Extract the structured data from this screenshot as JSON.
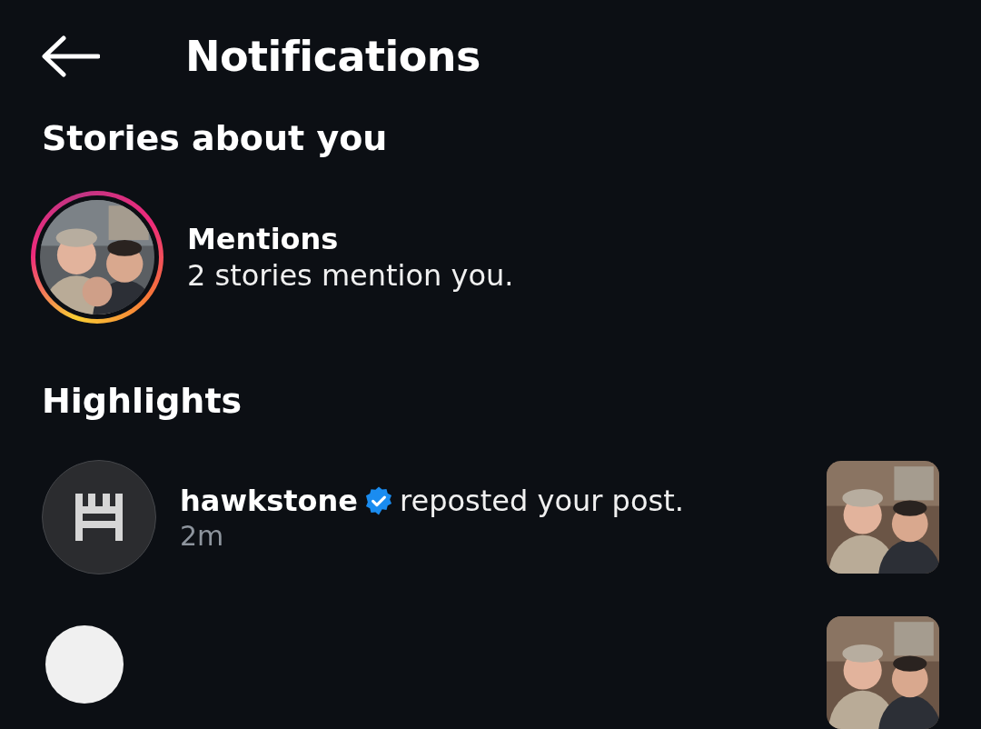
{
  "header": {
    "title": "Notifications"
  },
  "sections": [
    {
      "title": "Stories about you",
      "items": [
        {
          "kind": "story",
          "title": "Mentions",
          "subtitle": "2 stories mention you."
        }
      ]
    },
    {
      "title": "Highlights",
      "items": [
        {
          "kind": "repost",
          "user": "hawkstone",
          "verified": true,
          "action": "reposted your post.",
          "time": "2m"
        },
        {
          "kind": "partial"
        }
      ]
    }
  ]
}
